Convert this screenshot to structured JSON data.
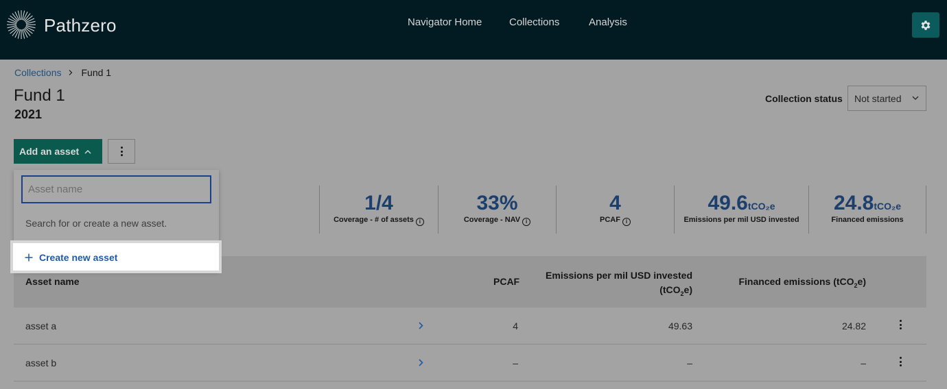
{
  "header": {
    "brand": "Pathzero",
    "nav": [
      "Navigator Home",
      "Collections",
      "Analysis"
    ]
  },
  "breadcrumb": {
    "parent": "Collections",
    "current": "Fund 1"
  },
  "page": {
    "title": "Fund 1",
    "year": "2021"
  },
  "status": {
    "label": "Collection status",
    "value": "Not started"
  },
  "toolbar": {
    "add_label": "Add an asset"
  },
  "dropdown": {
    "placeholder": "Asset name",
    "hint": "Search for or create a new asset.",
    "create_label": "Create new asset"
  },
  "metrics": [
    {
      "value": "1/4",
      "unit": "",
      "label": "Coverage - # of assets",
      "info": true
    },
    {
      "value": "33%",
      "unit": "",
      "label": "Coverage - NAV",
      "info": true
    },
    {
      "value": "4",
      "unit": "",
      "label": "PCAF",
      "info": true
    },
    {
      "value": "49.6",
      "unit": "tCO₂e",
      "label": "Emissions per mil USD invested",
      "info": false
    },
    {
      "value": "24.8",
      "unit": "tCO₂e",
      "label": "Financed emissions",
      "info": false
    }
  ],
  "table": {
    "headers": {
      "asset_name": "Asset name",
      "pcaf": "PCAF",
      "emissions_line1": "Emissions per mil USD invested",
      "emissions_line2_pre": "(tCO",
      "emissions_line2_sub": "2",
      "emissions_line2_post": "e)",
      "financed_pre": "Financed emissions (tCO",
      "financed_sub": "2",
      "financed_post": "e)"
    },
    "rows": [
      {
        "name": "asset a",
        "pcaf": "4",
        "emissions": "49.63",
        "financed": "24.82"
      },
      {
        "name": "asset b",
        "pcaf": "–",
        "emissions": "–",
        "financed": "–"
      }
    ]
  },
  "colors": {
    "topbar": "#021a22",
    "accent_button": "#0a5a4e",
    "gear_button": "#0b5a5c",
    "metric_value": "#1c3f6e",
    "link": "#1f5aa8"
  }
}
